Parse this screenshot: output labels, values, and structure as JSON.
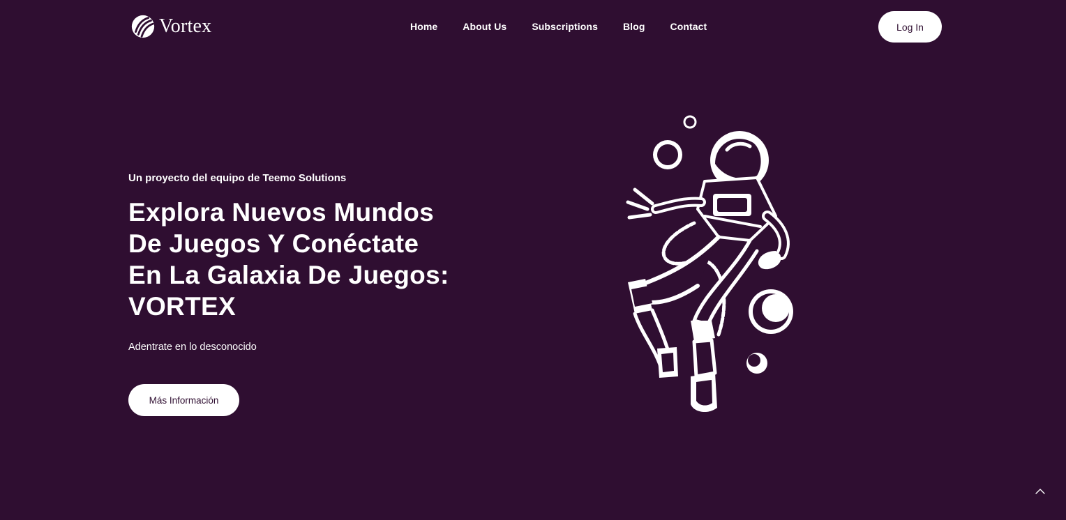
{
  "brand": {
    "name": "Vortex",
    "logo_icon": "vortex-swirl-icon"
  },
  "nav": {
    "items": [
      {
        "label": "Home"
      },
      {
        "label": "About Us"
      },
      {
        "label": "Subscriptions"
      },
      {
        "label": "Blog"
      },
      {
        "label": "Contact"
      }
    ],
    "login_label": "Log In"
  },
  "hero": {
    "eyebrow": "Un proyecto del equipo de Teemo Solutions",
    "title_lines": [
      "Explora Nuevos Mundos",
      "De Juegos Y Conéctate",
      "En La Galaxia De Juegos:",
      "VORTEX"
    ],
    "subtitle": "Adentrate en lo desconocido",
    "cta_label": "Más Información",
    "illustration_icon": "astronaut-illustration-icon"
  },
  "scroll_top_icon": "chevron-up-icon",
  "colors": {
    "background": "#2f0e31",
    "text": "#ffffff",
    "button_bg": "#ffffff",
    "button_text": "#2f0e31"
  }
}
